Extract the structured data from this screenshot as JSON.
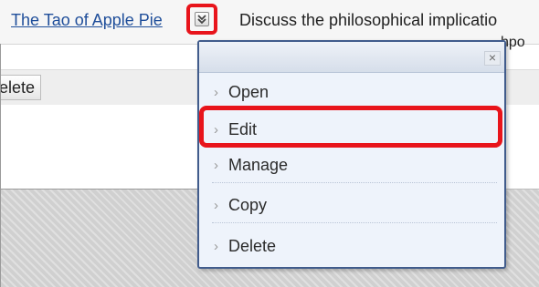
{
  "item": {
    "title": "The Tao of Apple Pie",
    "description_line1": "Discuss the philosophical implicatio",
    "description_line2": "hpo"
  },
  "actions": {
    "delete_label": "Delete",
    "delete_visible": "elete"
  },
  "context_menu": {
    "close_glyph": "×",
    "items": [
      {
        "label": "Open"
      },
      {
        "label": "Edit",
        "highlighted": true
      },
      {
        "label": "Manage"
      },
      {
        "label": "Copy"
      },
      {
        "label": "Delete"
      }
    ]
  },
  "icons": {
    "menu_trigger": "double-chevron-down-icon",
    "item_chevron": "chevron-right-icon",
    "close": "close-icon"
  },
  "colors": {
    "highlight": "#e8141b",
    "link": "#1f4e9a",
    "menu_border": "#415c8c",
    "menu_bg": "#eef3fb"
  }
}
